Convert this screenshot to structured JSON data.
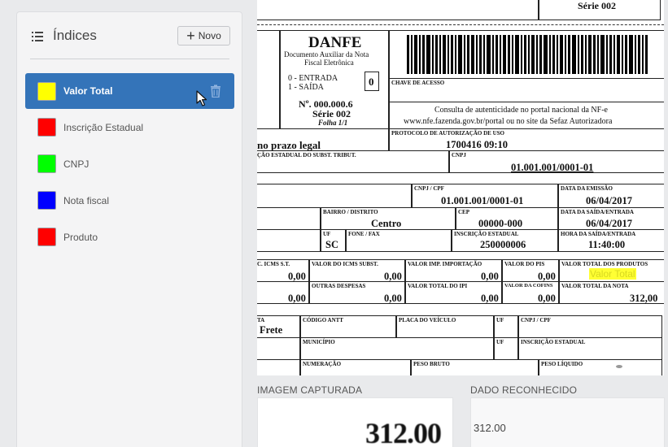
{
  "sidebar": {
    "title": "Índices",
    "new_button": "Novo",
    "items": [
      {
        "label": "Valor Total",
        "color": "#ffff00",
        "selected": true
      },
      {
        "label": "Inscrição Estadual",
        "color": "#ff0000"
      },
      {
        "label": "CNPJ",
        "color": "#00ff00"
      },
      {
        "label": "Nota fiscal",
        "color": "#0000ff"
      },
      {
        "label": "Produto",
        "color": "#ff0000"
      }
    ]
  },
  "document": {
    "serie_top": "Série 002",
    "danfe": "DANFE",
    "danfe_sub1": "Documento Auxiliar da Nota",
    "danfe_sub2": "Fiscal Eletrônica",
    "entrada": "0 - ENTRADA",
    "saida": "1 - SAÍDA",
    "tipo": "0",
    "numero": "Nº. 000.000.6",
    "serie": "Série 002",
    "folha": "Folha 1/1",
    "chave_label": "CHAVE DE ACESSO",
    "consulta1": "Consulta de autenticidade no portal nacional da NF-e",
    "consulta2": "www.nfe.fazenda.gov.br/portal ou no site da Sefaz Autorizadora",
    "prazo": "no prazo legal",
    "protocolo_label": "PROTOCOLO DE AUTORIZAÇÃO DE USO",
    "protocolo": "1700416    09:10",
    "subst_label": "ÇÃO ESTADUAL DO SUBST. TRIBUT.",
    "cnpj_label": "CNPJ",
    "cnpj_value": "01.001.001/0001-01",
    "cnpj_cpf_label": "CNPJ / CPF",
    "cnpj_cpf_value": "01.001.001/0001-01",
    "emissao_label": "DATA DA EMISSÃO",
    "emissao": "06/04/2017",
    "bairro_label": "BAIRRO / DISTRITO",
    "bairro": "Centro",
    "cep_label": "CEP",
    "cep": "00000-000",
    "saida_label": "DATA DA SAÍDA/ENTRADA",
    "saida_data": "06/04/2017",
    "uf_label": "UF",
    "uf": "SC",
    "fone_label": "FONE / FAX",
    "ie_label": "INSCRIÇÃO ESTADUAL",
    "ie": "250000006",
    "hora_label": "HORA DA SAÍDA/ENTRADA",
    "hora": "11:40:00",
    "icms_st_label": "C. ICMS S.T.",
    "icms_st": "0,00",
    "icms_subst_label": "VALOR DO ICMS SUBST.",
    "icms_subst": "0,00",
    "imp_label": "VALOR IMP. IMPORTAÇÃO",
    "imp": "0,00",
    "pis_label": "VALOR DO PIS",
    "pis": "0,00",
    "prod_label": "VALOR TOTAL DOS PRODUTOS",
    "highlight": "Valor Total",
    "row2_first": "0,00",
    "outras_label": "OUTRAS DESPESAS",
    "outras": "0,00",
    "ipi_label": "VALOR TOTAL DO IPI",
    "ipi": "0,00",
    "cofins_label": "VALOR DA COFINS",
    "cofins": "0,00",
    "total_label": "VALOR TOTAL DA NOTA",
    "total": "312,00",
    "frete_label": "TA",
    "frete": "Frete",
    "antt_label": "CÓDIGO ANTT",
    "placa_label": "PLACA DO VEÍCULO",
    "uf2_label": "UF",
    "cnpj2_label": "CNPJ / CPF",
    "municipio_label": "MUNICÍPIO",
    "uf3_label": "UF",
    "ie2_label": "INSCRIÇÃO ESTADUAL",
    "numeracao_label": "NUMERAÇÃO",
    "bruto_label": "PESO BRUTO",
    "liquido_label": "PESO LÍQUIDO"
  },
  "captured": {
    "title": "IMAGEM CAPTURADA",
    "value": "312.00"
  },
  "recognized": {
    "title": "DADO RECONHECIDO",
    "value": "312.00"
  }
}
